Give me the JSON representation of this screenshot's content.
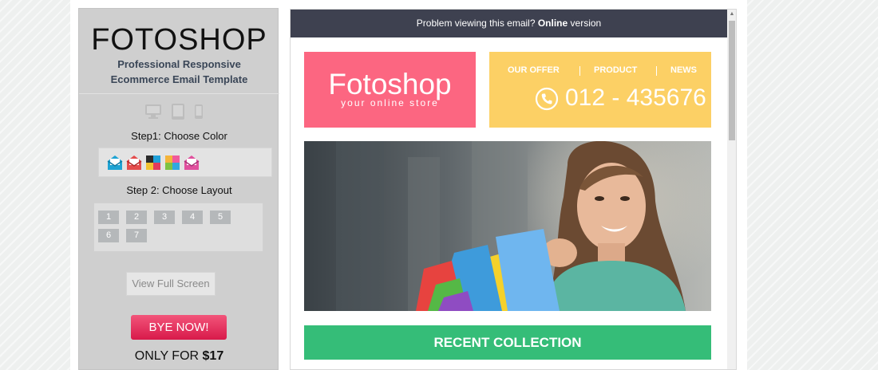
{
  "sidebar": {
    "brand": "FOTOSHOP",
    "subtitle_line1": "Professional Responsive",
    "subtitle_line2": "Ecommerce Email Template",
    "device_icons": [
      "desktop-icon",
      "tablet-icon",
      "phone-icon"
    ],
    "step1_label": "Step1: Choose Color",
    "color_swatches": [
      {
        "name": "email-teal-icon",
        "color": "#1ea3d3"
      },
      {
        "name": "email-red-icon",
        "color": "#e44c4c"
      },
      {
        "name": "palette-multicolor-icon",
        "color": "#333333"
      },
      {
        "name": "palette-colorful-icon",
        "color": "#f4b43a"
      },
      {
        "name": "email-pink-icon",
        "color": "#e0509d"
      }
    ],
    "step2_label": "Step 2: Choose Layout",
    "layouts": [
      "1",
      "2",
      "3",
      "4",
      "5",
      "6",
      "7"
    ],
    "full_screen_label": "View Full Screen",
    "buy_label": "BYE NOW!",
    "price_prefix": "ONLY FOR ",
    "price_value": "$17"
  },
  "email": {
    "topbar_text": "Problem viewing this email? ",
    "topbar_link": "Online",
    "topbar_suffix": " version",
    "logo_title": "Fotoshop",
    "logo_tagline": "your online store",
    "nav": [
      "OUR OFFER",
      "PRODUCT",
      "NEWS"
    ],
    "phone": "012 - 435676",
    "banner_label": "RECENT COLLECTION"
  },
  "colors": {
    "logo_bg": "#fc6681",
    "nav_bg": "#fcd065",
    "banner_bg": "#35bd78",
    "buy_bg": "#e9305e",
    "topbar_bg": "#3e4150"
  }
}
